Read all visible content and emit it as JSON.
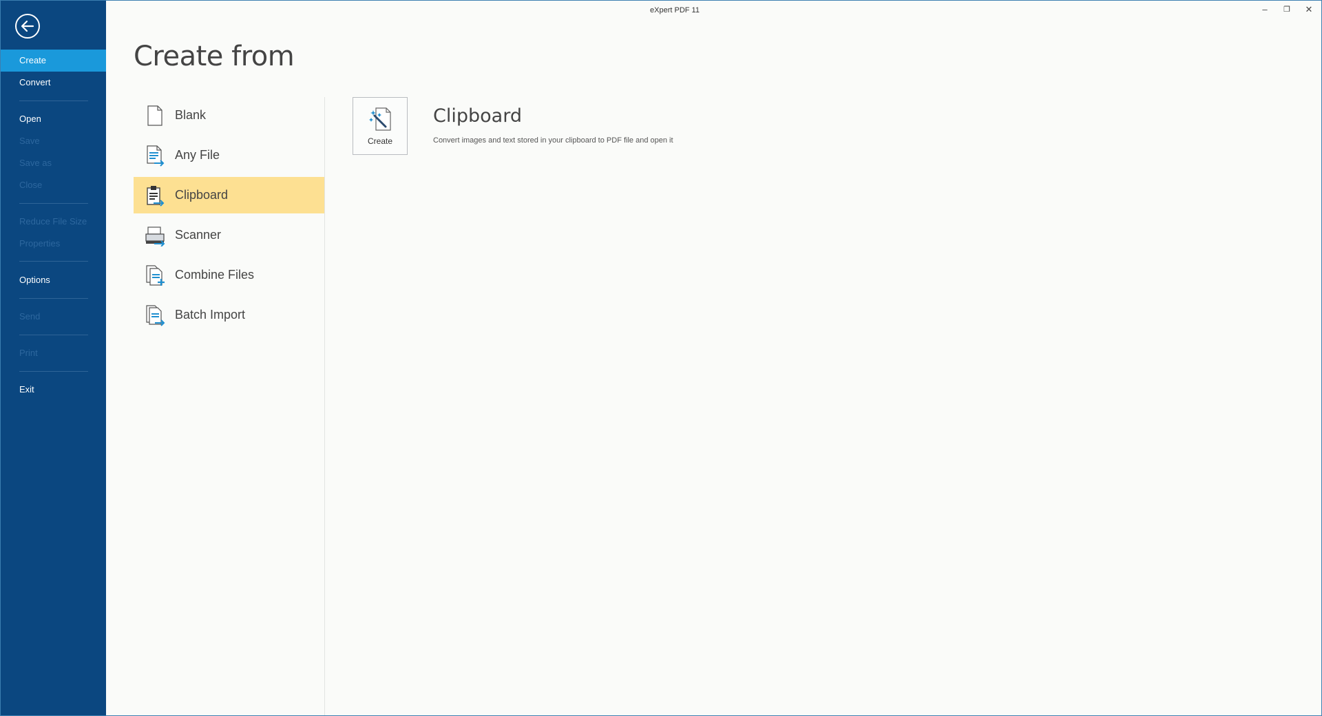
{
  "window": {
    "title": "eXpert PDF 11",
    "controls": {
      "minimize": "–",
      "restore": "❐",
      "close": "✕"
    }
  },
  "sidebar": {
    "back_icon": "back-arrow-icon",
    "items": [
      {
        "label": "Create",
        "state": "active"
      },
      {
        "label": "Convert",
        "state": "enabled"
      },
      {
        "label": "Open",
        "state": "enabled"
      },
      {
        "label": "Save",
        "state": "disabled"
      },
      {
        "label": "Save as",
        "state": "disabled"
      },
      {
        "label": "Close",
        "state": "disabled"
      },
      {
        "label": "Reduce File Size",
        "state": "disabled"
      },
      {
        "label": "Properties",
        "state": "disabled"
      },
      {
        "label": "Options",
        "state": "enabled"
      },
      {
        "label": "Send",
        "state": "disabled"
      },
      {
        "label": "Print",
        "state": "disabled"
      },
      {
        "label": "Exit",
        "state": "enabled"
      }
    ]
  },
  "main": {
    "heading": "Create from",
    "sources": [
      {
        "label": "Blank",
        "icon": "blank-page-icon"
      },
      {
        "label": "Any File",
        "icon": "any-file-icon"
      },
      {
        "label": "Clipboard",
        "icon": "clipboard-icon",
        "selected": true
      },
      {
        "label": "Scanner",
        "icon": "scanner-icon"
      },
      {
        "label": "Combine Files",
        "icon": "combine-files-icon"
      },
      {
        "label": "Batch Import",
        "icon": "batch-import-icon"
      }
    ],
    "detail": {
      "button_label": "Create",
      "button_icon": "magic-wand-page-icon",
      "title": "Clipboard",
      "description": "Convert images and text stored in your clipboard to PDF file and open it"
    }
  },
  "colors": {
    "sidebar_bg": "#0b4780",
    "sidebar_active": "#1a99db",
    "selected_item": "#fde092",
    "icon_blue": "#1f8fd0"
  }
}
